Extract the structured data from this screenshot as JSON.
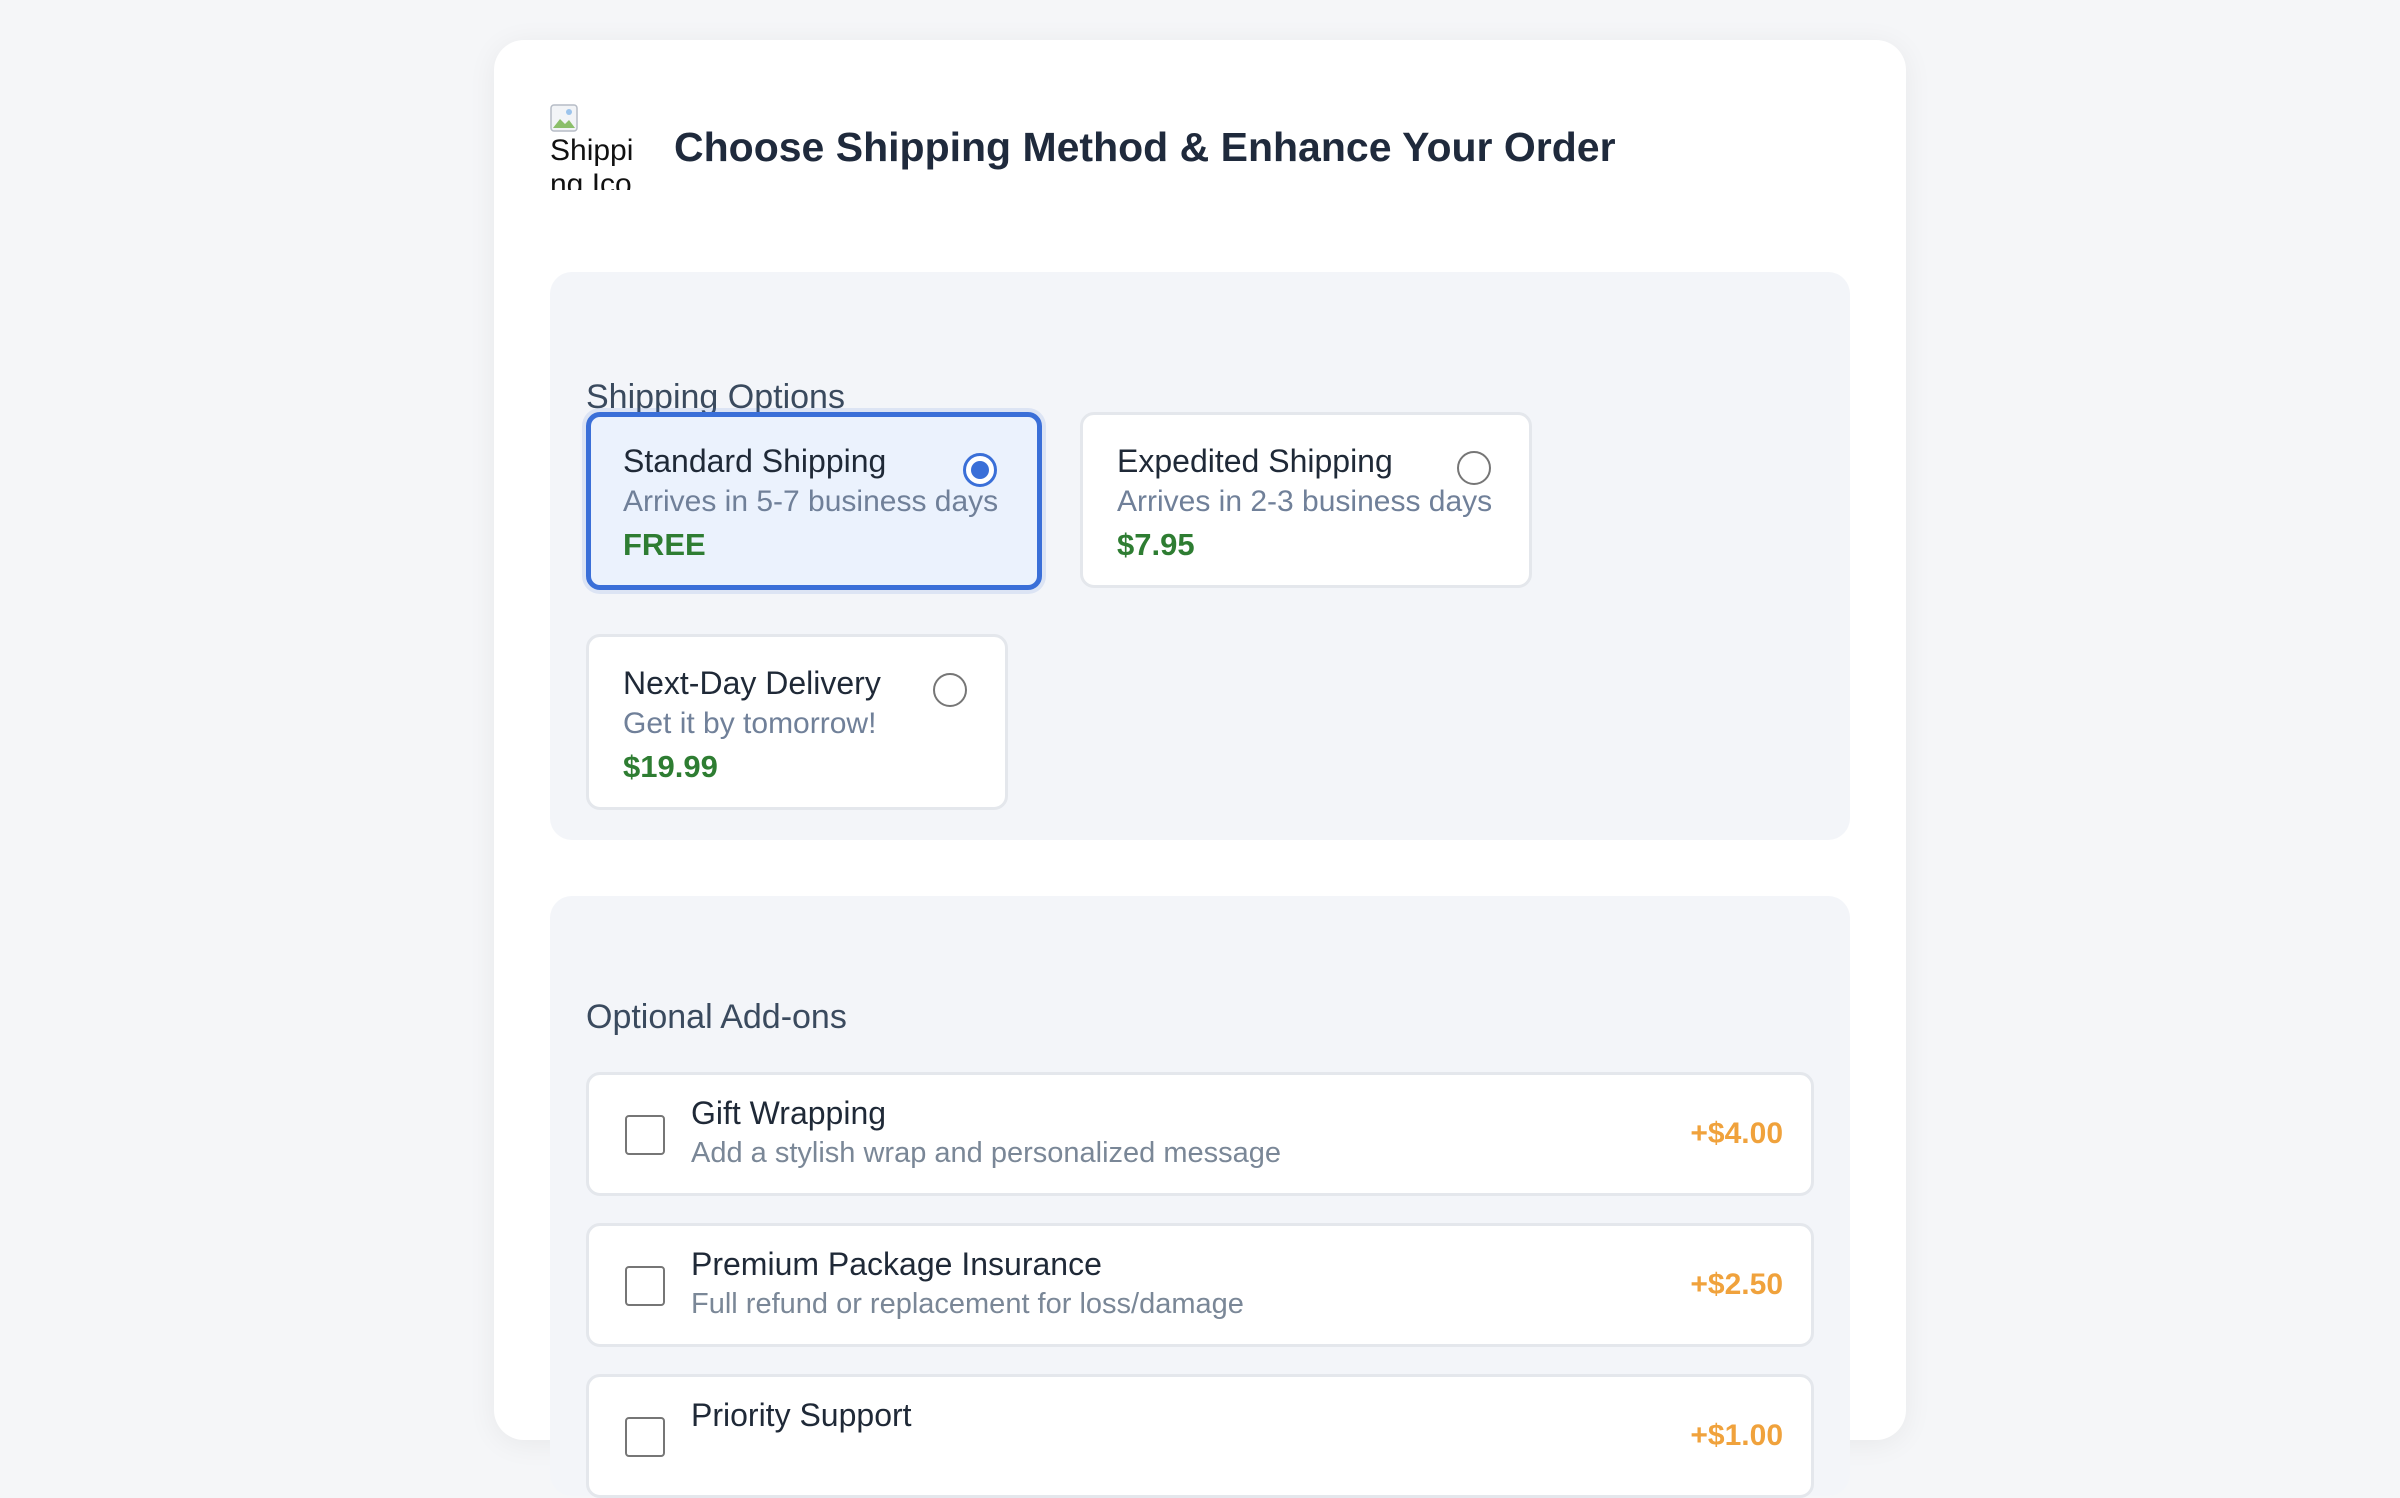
{
  "header": {
    "icon_alt": "Shipping Icon",
    "title": "Choose Shipping Method & Enhance Your Order"
  },
  "shipping": {
    "section_title": "Shipping Options",
    "options": [
      {
        "name": "Standard Shipping",
        "desc": "Arrives in 5-7 business days",
        "price": "FREE",
        "selected": true
      },
      {
        "name": "Expedited Shipping",
        "desc": "Arrives in 2-3 business days",
        "price": "$7.95",
        "selected": false
      },
      {
        "name": "Next-Day Delivery",
        "desc": "Get it by tomorrow!",
        "price": "$19.99",
        "selected": false
      }
    ]
  },
  "addons": {
    "section_title": "Optional Add-ons",
    "items": [
      {
        "name": "Gift Wrapping",
        "desc": "Add a stylish wrap and personalized message",
        "price": "+$4.00",
        "checked": false
      },
      {
        "name": "Premium Package Insurance",
        "desc": "Full refund or replacement for loss/damage",
        "price": "+$2.50",
        "checked": false
      },
      {
        "name": "Priority Support",
        "desc": "",
        "price": "+$1.00",
        "checked": false
      }
    ]
  },
  "colors": {
    "accent": "#3a6fd8",
    "price_green": "#2e7d32",
    "addon_price": "#f0a23c"
  }
}
